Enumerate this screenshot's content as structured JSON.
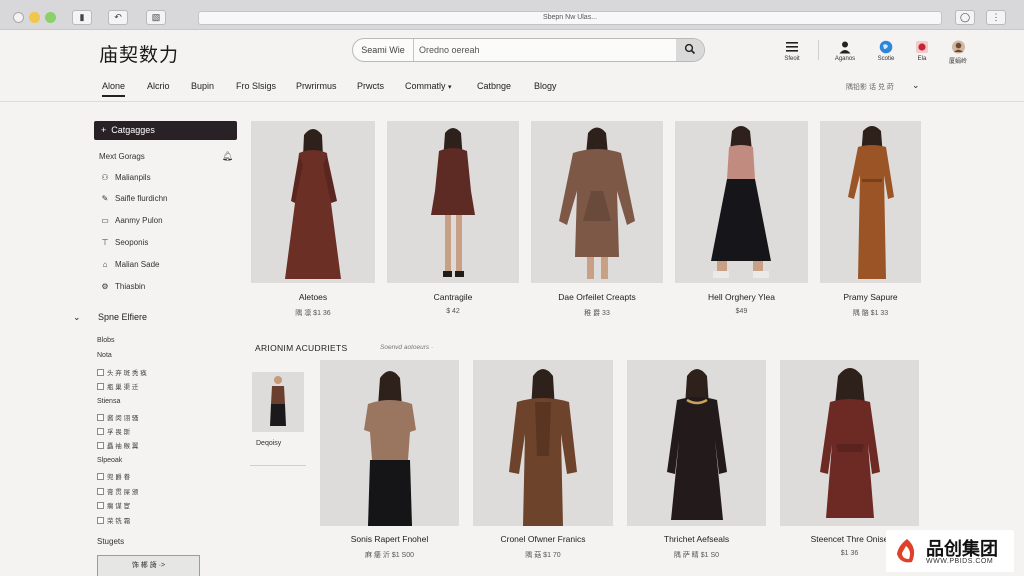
{
  "browser": {
    "url": "Sbepn Nw Ulas..."
  },
  "header": {
    "logo": "庙契数力",
    "search_scope": "Seami Wie",
    "search_placeholder": "Oredno oereah",
    "icons": [
      {
        "icon": "menu-icon",
        "label": "Sfeoit"
      },
      {
        "icon": "user-icon",
        "label": "Aganos"
      },
      {
        "icon": "globe-icon",
        "label": "Scotie"
      },
      {
        "icon": "flag-icon",
        "label": "Ela"
      },
      {
        "icon": "avatar",
        "label": "厦娟岭"
      }
    ]
  },
  "nav": {
    "items": [
      "Alone",
      "Alcrio",
      "Bupin",
      "Fro Slsigs",
      "Prwrirmus",
      "Prwcts",
      "Commatly",
      "Catbnge",
      "Blogy"
    ],
    "right": "隅铅影 话 兑 莳"
  },
  "sidebar": {
    "categories_button": "Catgagges",
    "heading": "Mext Gorags",
    "items": [
      {
        "icon": "tag-icon",
        "label": "Malianpils"
      },
      {
        "icon": "pen-icon",
        "label": "Saifle flurdichn"
      },
      {
        "icon": "card-icon",
        "label": "Aanmy Pulon"
      },
      {
        "icon": "filter-icon",
        "label": "Seoponis"
      },
      {
        "icon": "shoe-icon",
        "label": "Malian Sade"
      },
      {
        "icon": "gear-icon",
        "label": "Thiasbin"
      }
    ],
    "section_title": "Spne Elfiere",
    "groups": [
      {
        "label": "Blobs",
        "checks": []
      },
      {
        "label": "Nota",
        "checks": [
          "头 弃 斑 秃 痪",
          "瓶 巢 渠 迁"
        ]
      },
      {
        "label": "Stiensa",
        "checks": [
          "酱 闵 诩 骚",
          "孚 畏 斯",
          "矗 袖 糇 翼"
        ]
      },
      {
        "label": "Slpeoak",
        "checks": [
          "兜 爵 眷",
          "膏 贯 屎 颁",
          "瘸 谋 宦",
          "荣 铣 霜"
        ]
      }
    ],
    "apply_label": "饰 郴 旖 ·>"
  },
  "products": [
    {
      "name": "Aletoes",
      "price": "隅 凛 $1 36"
    },
    {
      "name": "Cantragile",
      "price": "$ 42"
    },
    {
      "name": "Dae Orfeilet Creapts",
      "price": "稚 爵 33"
    },
    {
      "name": "Hell Orghery Ylea",
      "price": "$49"
    },
    {
      "name": "Pramy Sapure",
      "price": "隅 骼 $1 33"
    }
  ],
  "recommended": {
    "title": "ARIONIM ACUDRIETS",
    "subtitle": "Soenvd aotoeurs ·",
    "mini_label": "Deqoisy",
    "items": [
      {
        "name": "Sonis Rapert Fnohel",
        "price": "麻 痿 沂 $1 S00"
      },
      {
        "name": "Cronel Ofwner Franics",
        "price": "隅 菇 $1 70"
      },
      {
        "name": "Thrichet Aefseals",
        "price": "隅 萨 睛 $1 S0"
      },
      {
        "name": "Steencet Thre Onise",
        "price": "$1 36"
      }
    ]
  },
  "watermark": {
    "brand": "品创集团",
    "url": "WWW.PBIDS.COM"
  },
  "colors": {
    "nav_dark": "#2a2127",
    "page_bg": "#f4f3f1",
    "photo_bg": "#dddcda"
  }
}
